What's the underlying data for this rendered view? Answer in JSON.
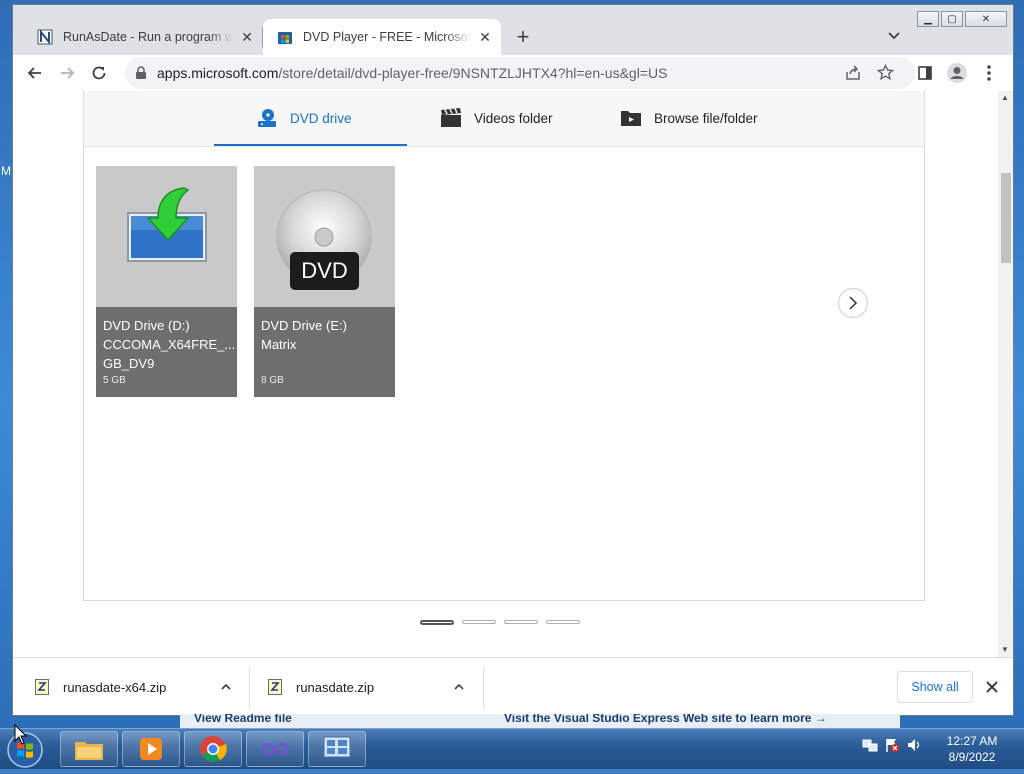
{
  "desktop": {
    "edge_letter": "M"
  },
  "browser": {
    "tabs": [
      {
        "title": "RunAsDate - Run a program with",
        "active": false
      },
      {
        "title": "DVD Player - FREE - Microsoft St",
        "active": true
      }
    ],
    "new_tab_symbol": "+",
    "window_controls": {
      "minimize": "▁",
      "maximize": "▢",
      "close": "✕"
    },
    "address": {
      "host": "apps.microsoft.com",
      "path": "/store/detail/dvd-player-free/9NSNTZLJHTX4?hl=en-us&gl=US"
    }
  },
  "page": {
    "source_tabs": [
      {
        "label": "DVD drive",
        "icon": "dvd-drive-icon",
        "active": true
      },
      {
        "label": "Videos folder",
        "icon": "clapperboard-icon",
        "active": false
      },
      {
        "label": "Browse file/folder",
        "icon": "folder-browse-icon",
        "active": false
      }
    ],
    "drives": [
      {
        "name_line1": "DVD Drive (D:)",
        "name_line2": "CCCOMA_X64FRE_...",
        "name_line3": "GB_DV9",
        "size": "5 GB",
        "art": "monitor-download-icon"
      },
      {
        "name_line1": "DVD Drive (E:)",
        "name_line2": "Matrix",
        "name_line3": "",
        "size": "8 GB",
        "art": "dvd-disc-icon",
        "disc_label": "DVD"
      }
    ],
    "carousel": {
      "pages": 4,
      "active_page": 1
    }
  },
  "downloads": {
    "items": [
      {
        "filename": "runasdate-x64.zip"
      },
      {
        "filename": "runasdate.zip"
      }
    ],
    "show_all_label": "Show all"
  },
  "behind_window": {
    "left_text": "View Readme file",
    "right_text": "Visit the Visual Studio Express Web site to learn more →"
  },
  "taskbar": {
    "time": "12:27 AM",
    "date": "8/9/2022"
  },
  "colors": {
    "accent": "#1a73c8",
    "tile_bg": "#6e6e6e"
  }
}
